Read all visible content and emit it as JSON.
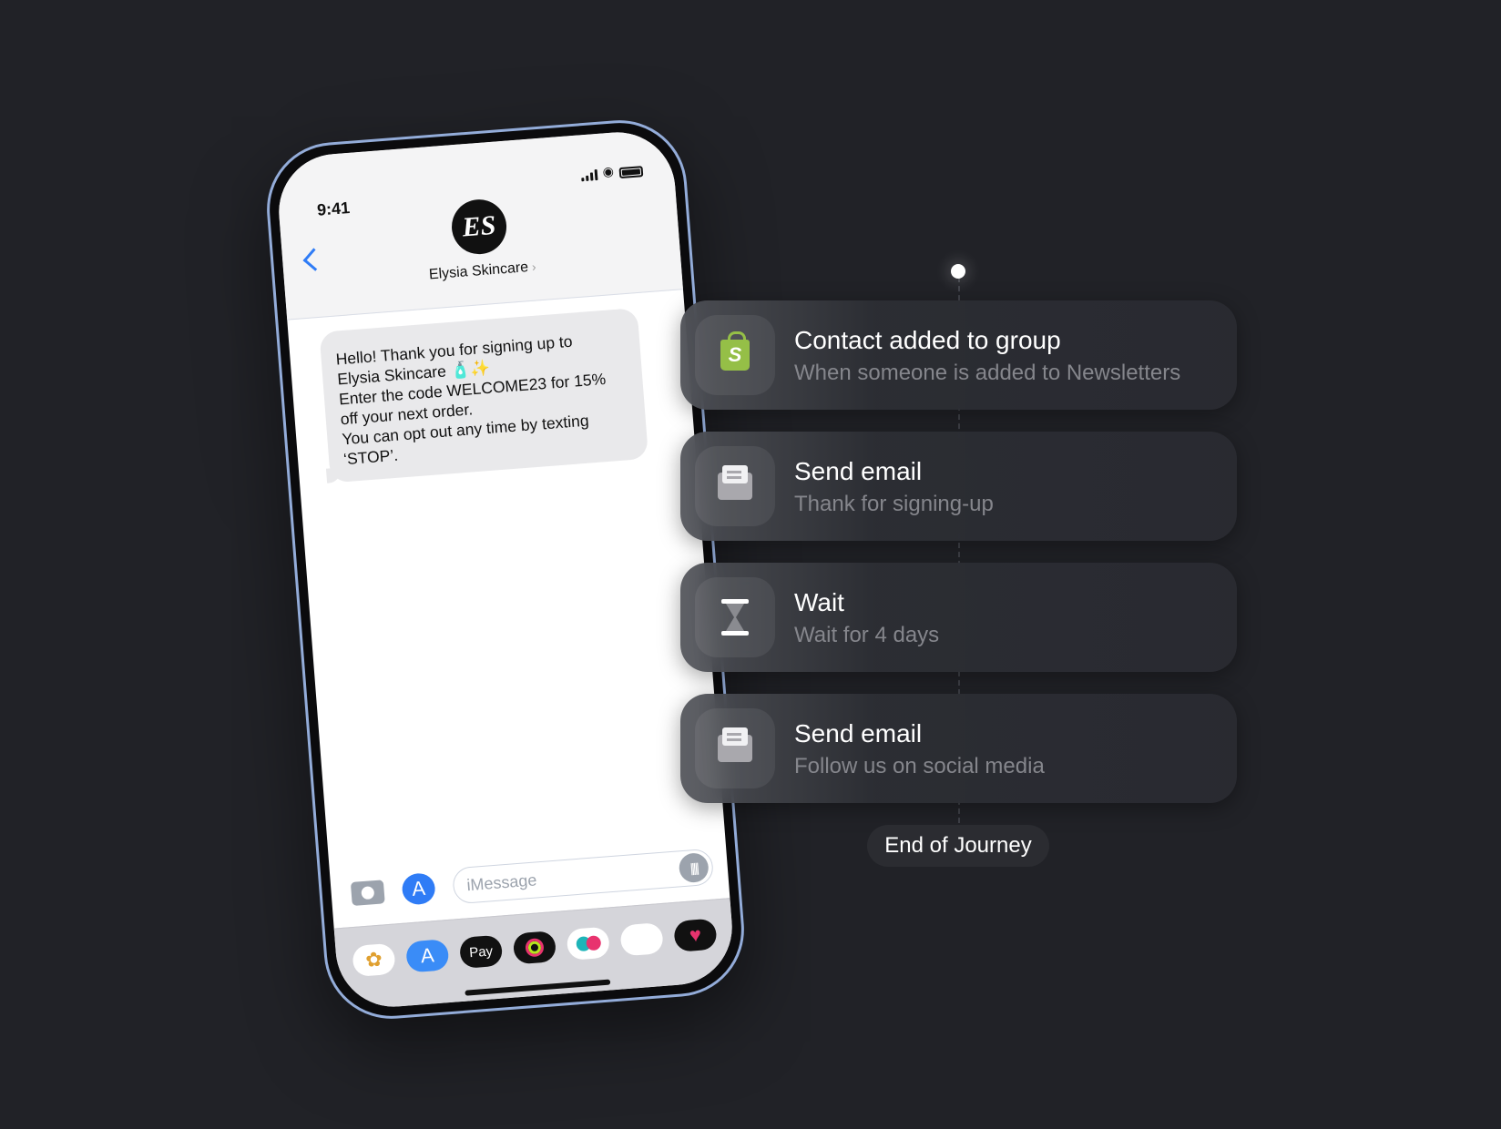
{
  "phone": {
    "status_time": "9:41",
    "contact": {
      "initials": "ES",
      "name": "Elysia Skincare"
    },
    "message_lines": [
      "Hello! Thank you for signing up to",
      "Elysia Skincare 🧴✨",
      "Enter the code WELCOME23 for 15%",
      "off your next order.",
      "You can opt out any time by texting",
      "‘STOP’."
    ],
    "input_placeholder": "iMessage",
    "dock_apps": [
      "photos",
      "app-store",
      "apple-pay",
      "activity",
      "digital-touch",
      "memoji",
      "heart-stickers"
    ],
    "apple_pay_label": "Pay"
  },
  "journey": {
    "steps": [
      {
        "icon": "shopify-bag-icon",
        "title": "Contact added to group",
        "subtitle": "When someone is added to Newsletters"
      },
      {
        "icon": "envelope-open-icon",
        "title": "Send email",
        "subtitle": "Thank for signing-up"
      },
      {
        "icon": "hourglass-icon",
        "title": "Wait",
        "subtitle": "Wait for 4 days"
      },
      {
        "icon": "envelope-open-icon",
        "title": "Send email",
        "subtitle": "Follow us on social media"
      }
    ],
    "end_label": "End of Journey"
  },
  "colors": {
    "background": "#212227",
    "accent_blue": "#2f7cf6",
    "shopify_green": "#95bf47"
  }
}
